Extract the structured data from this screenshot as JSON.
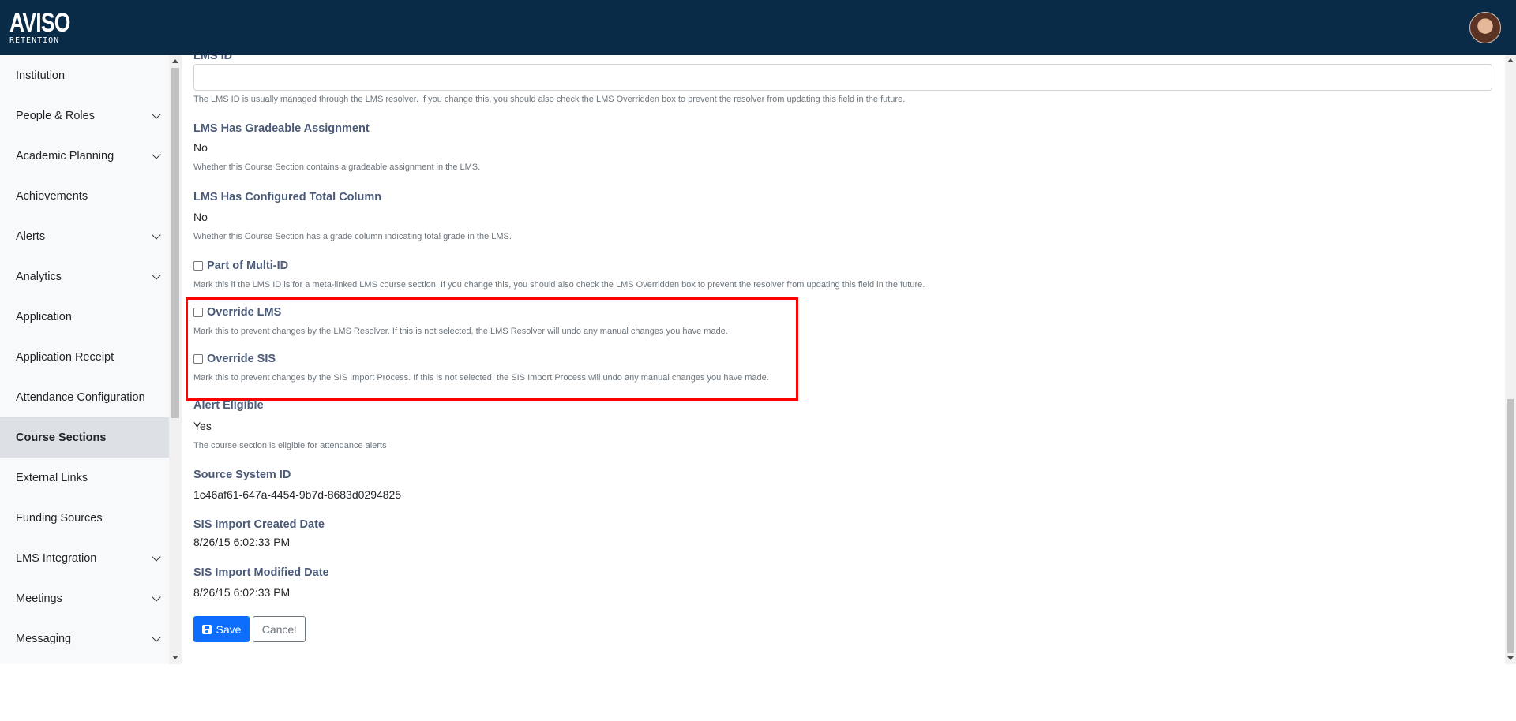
{
  "header": {
    "logo_text": "AVISO",
    "logo_subtext": "RETENTION",
    "avatar_icon": "user-avatar"
  },
  "sidebar": {
    "items": [
      {
        "label": "Institution",
        "has_chevron": false,
        "active": false
      },
      {
        "label": "People & Roles",
        "has_chevron": true,
        "active": false
      },
      {
        "label": "Academic Planning",
        "has_chevron": true,
        "active": false
      },
      {
        "label": "Achievements",
        "has_chevron": false,
        "active": false
      },
      {
        "label": "Alerts",
        "has_chevron": true,
        "active": false
      },
      {
        "label": "Analytics",
        "has_chevron": true,
        "active": false
      },
      {
        "label": "Application",
        "has_chevron": false,
        "active": false
      },
      {
        "label": "Application Receipt",
        "has_chevron": false,
        "active": false
      },
      {
        "label": "Attendance Configuration",
        "has_chevron": false,
        "active": false
      },
      {
        "label": "Course Sections",
        "has_chevron": false,
        "active": true
      },
      {
        "label": "External Links",
        "has_chevron": false,
        "active": false
      },
      {
        "label": "Funding Sources",
        "has_chevron": false,
        "active": false
      },
      {
        "label": "LMS Integration",
        "has_chevron": true,
        "active": false
      },
      {
        "label": "Meetings",
        "has_chevron": true,
        "active": false
      },
      {
        "label": "Messaging",
        "has_chevron": true,
        "active": false
      }
    ]
  },
  "form": {
    "lms_id": {
      "label": "LMS ID",
      "value": "",
      "help": "The LMS ID is usually managed through the LMS resolver. If you change this, you should also check the LMS Overridden box to prevent the resolver from updating this field in the future."
    },
    "lms_gradeable": {
      "label": "LMS Has Gradeable Assignment",
      "value": "No",
      "help": "Whether this Course Section contains a gradeable assignment in the LMS."
    },
    "lms_total_column": {
      "label": "LMS Has Configured Total Column",
      "value": "No",
      "help": "Whether this Course Section has a grade column indicating total grade in the LMS."
    },
    "multi_id": {
      "label": "Part of Multi-ID",
      "checked": false,
      "help": "Mark this if the LMS ID is for a meta-linked LMS course section. If you change this, you should also check the LMS Overridden box to prevent the resolver from updating this field in the future."
    },
    "override_lms": {
      "label": "Override LMS",
      "checked": false,
      "help": "Mark this to prevent changes by the LMS Resolver. If this is not selected, the LMS Resolver will undo any manual changes you have made."
    },
    "override_sis": {
      "label": "Override SIS",
      "checked": false,
      "help": "Mark this to prevent changes by the SIS Import Process. If this is not selected, the SIS Import Process will undo any manual changes you have made."
    },
    "alert_eligible": {
      "label": "Alert Eligible",
      "value": "Yes",
      "help": "The course section is eligible for attendance alerts"
    },
    "source_system_id": {
      "label": "Source System ID",
      "value": "1c46af61-647a-4454-9b7d-8683d0294825"
    },
    "sis_created": {
      "label": "SIS Import Created Date",
      "value": "8/26/15 6:02:33 PM"
    },
    "sis_modified": {
      "label": "SIS Import Modified Date",
      "value": "8/26/15 6:02:33 PM"
    }
  },
  "actions": {
    "save_label": "Save",
    "save_icon": "save-icon",
    "cancel_label": "Cancel"
  },
  "colors": {
    "topbar": "#0a2b47",
    "primary": "#0d6efd",
    "highlight_border": "#ff0000",
    "label": "#4a5a78"
  }
}
